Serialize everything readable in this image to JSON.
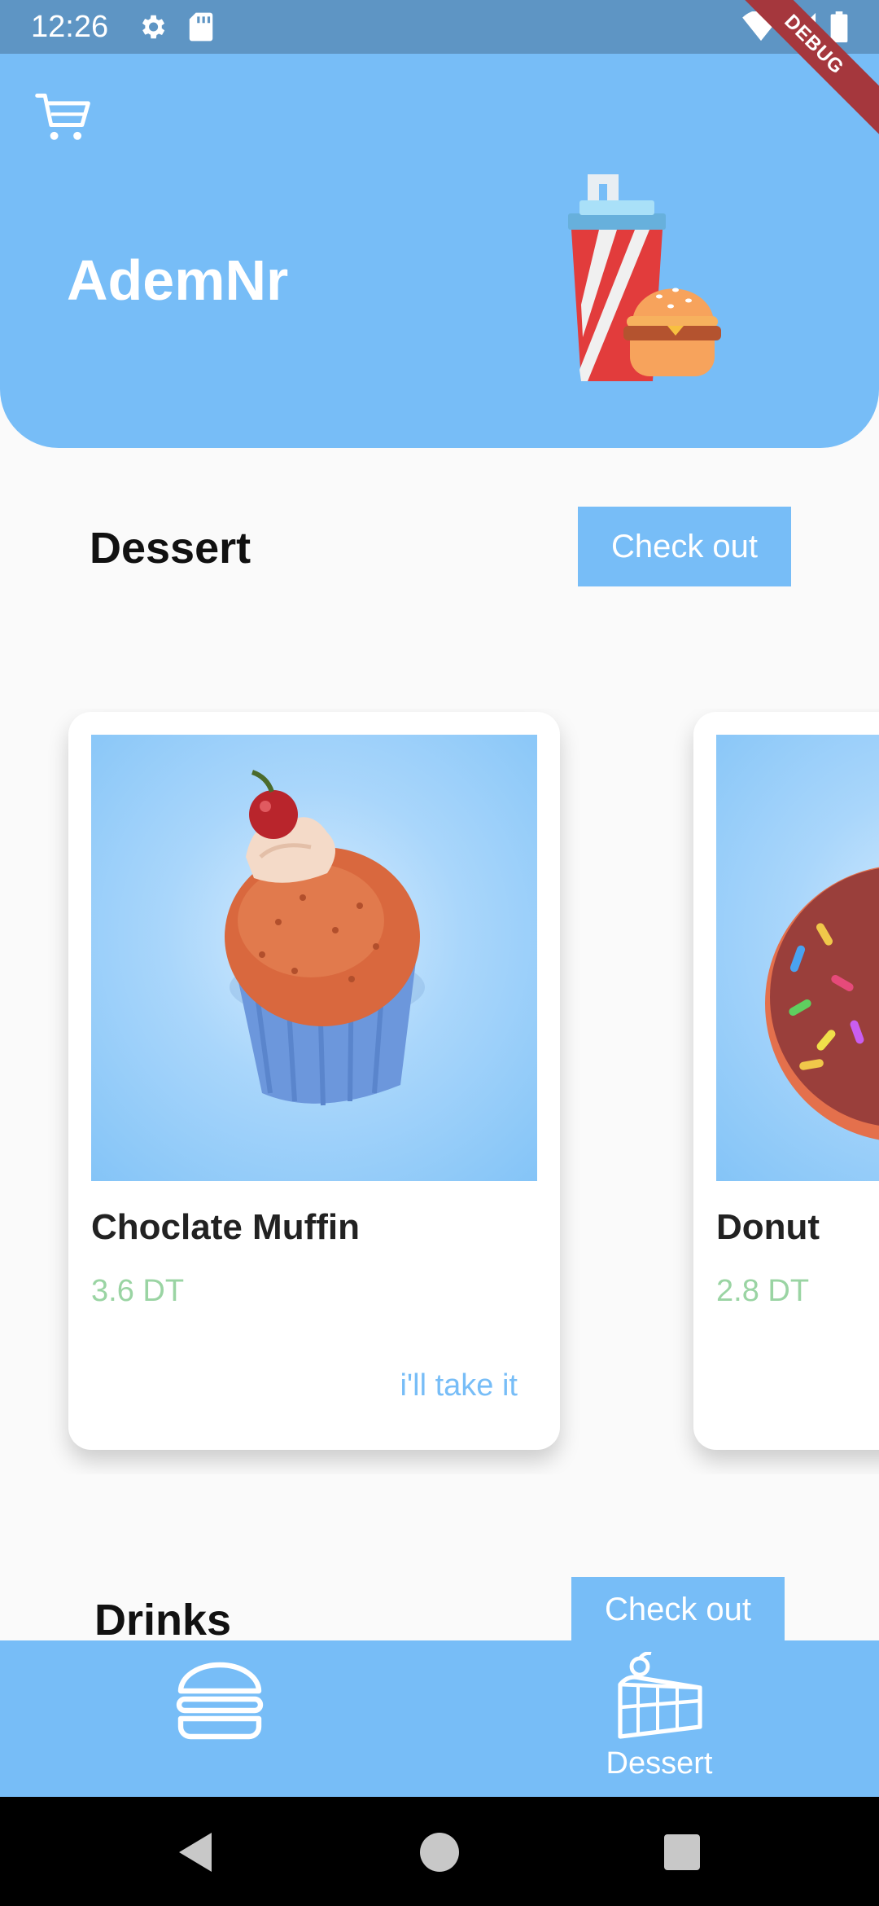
{
  "status_bar": {
    "time": "12:26",
    "icons": [
      "gear-icon",
      "sd-card-icon",
      "wifi-icon",
      "signal-icon",
      "battery-icon"
    ]
  },
  "debug_banner": "DEBUG",
  "header": {
    "title": "AdemNr",
    "cart_icon": "shopping-cart-icon",
    "illustration": "drink-and-burger-illustration"
  },
  "sections": [
    {
      "title": "Dessert",
      "checkout_label": "Check out"
    },
    {
      "title": "Drinks",
      "checkout_label": "Check out"
    }
  ],
  "products": [
    {
      "name": "Choclate Muffin",
      "price": "3.6 DT",
      "cta": "i'll take it",
      "image": "muffin-image"
    },
    {
      "name": "Donut",
      "price": "2.8 DT",
      "cta": "",
      "image": "donut-image"
    }
  ],
  "bottom_nav": {
    "items": [
      {
        "label": "",
        "icon": "burger-icon"
      },
      {
        "label": "Dessert",
        "icon": "cake-icon"
      }
    ]
  },
  "system_nav": [
    "back-icon",
    "home-icon",
    "recents-icon"
  ],
  "colors": {
    "primary": "#77bdf7",
    "status_bar": "#5e95c4",
    "price": "#9ad4a3",
    "background": "#fafafa",
    "debug": "#a5373d"
  }
}
